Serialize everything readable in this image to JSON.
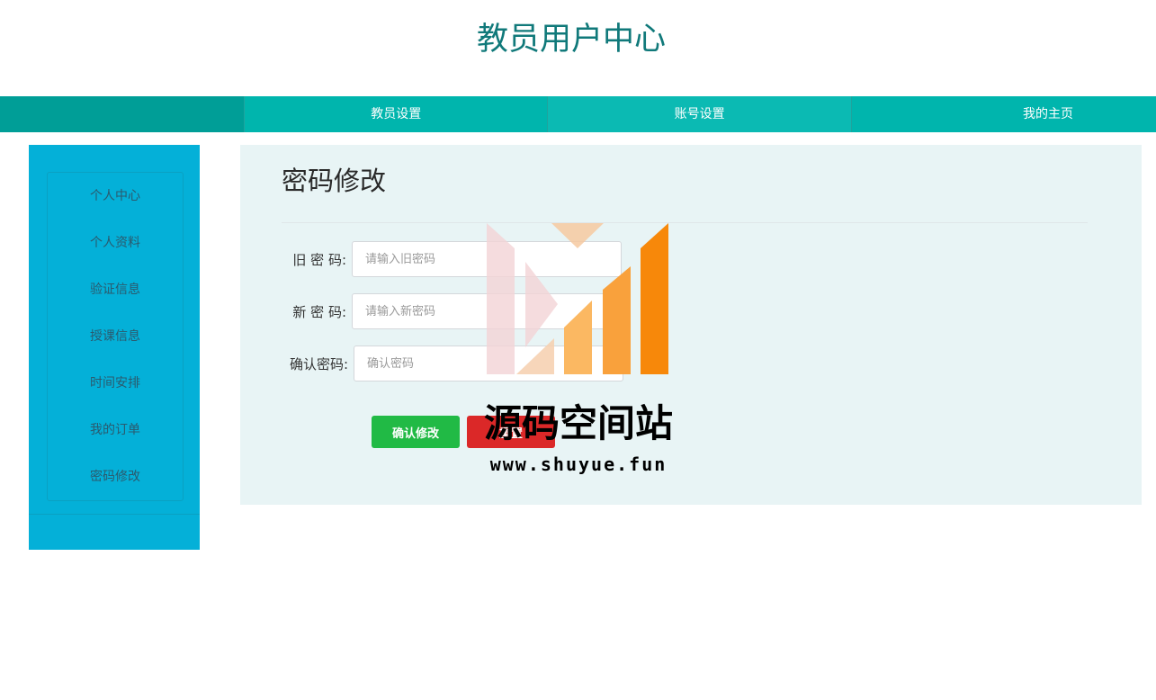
{
  "header": {
    "title": "教员用户中心"
  },
  "nav": {
    "items": [
      {
        "label": "教员设置"
      },
      {
        "label": "账号设置"
      },
      {
        "label": "我的主页"
      }
    ]
  },
  "sidebar": {
    "items": [
      {
        "label": "个人中心"
      },
      {
        "label": "个人资料"
      },
      {
        "label": "验证信息"
      },
      {
        "label": "授课信息"
      },
      {
        "label": "时间安排"
      },
      {
        "label": "我的订单"
      },
      {
        "label": "密码修改"
      }
    ]
  },
  "main": {
    "title": "密码修改",
    "form": {
      "old_password": {
        "label": "旧 密 码:",
        "placeholder": "请输入旧密码",
        "value": ""
      },
      "new_password": {
        "label": "新 密 码:",
        "placeholder": "请输入新密码",
        "value": ""
      },
      "confirm_password": {
        "label": "确认密码:",
        "placeholder": "确认密码",
        "value": ""
      }
    },
    "buttons": {
      "confirm": "确认修改",
      "reset": "重置"
    }
  },
  "watermark": {
    "text": "源码空间站",
    "url": "www.shuyue.fun"
  },
  "colors": {
    "title": "#10797a",
    "nav": "#00b5ad",
    "sidebar": "#04b0d8",
    "main_bg": "#e8f4f5",
    "confirm": "#21ba45",
    "reset": "#db2828"
  }
}
